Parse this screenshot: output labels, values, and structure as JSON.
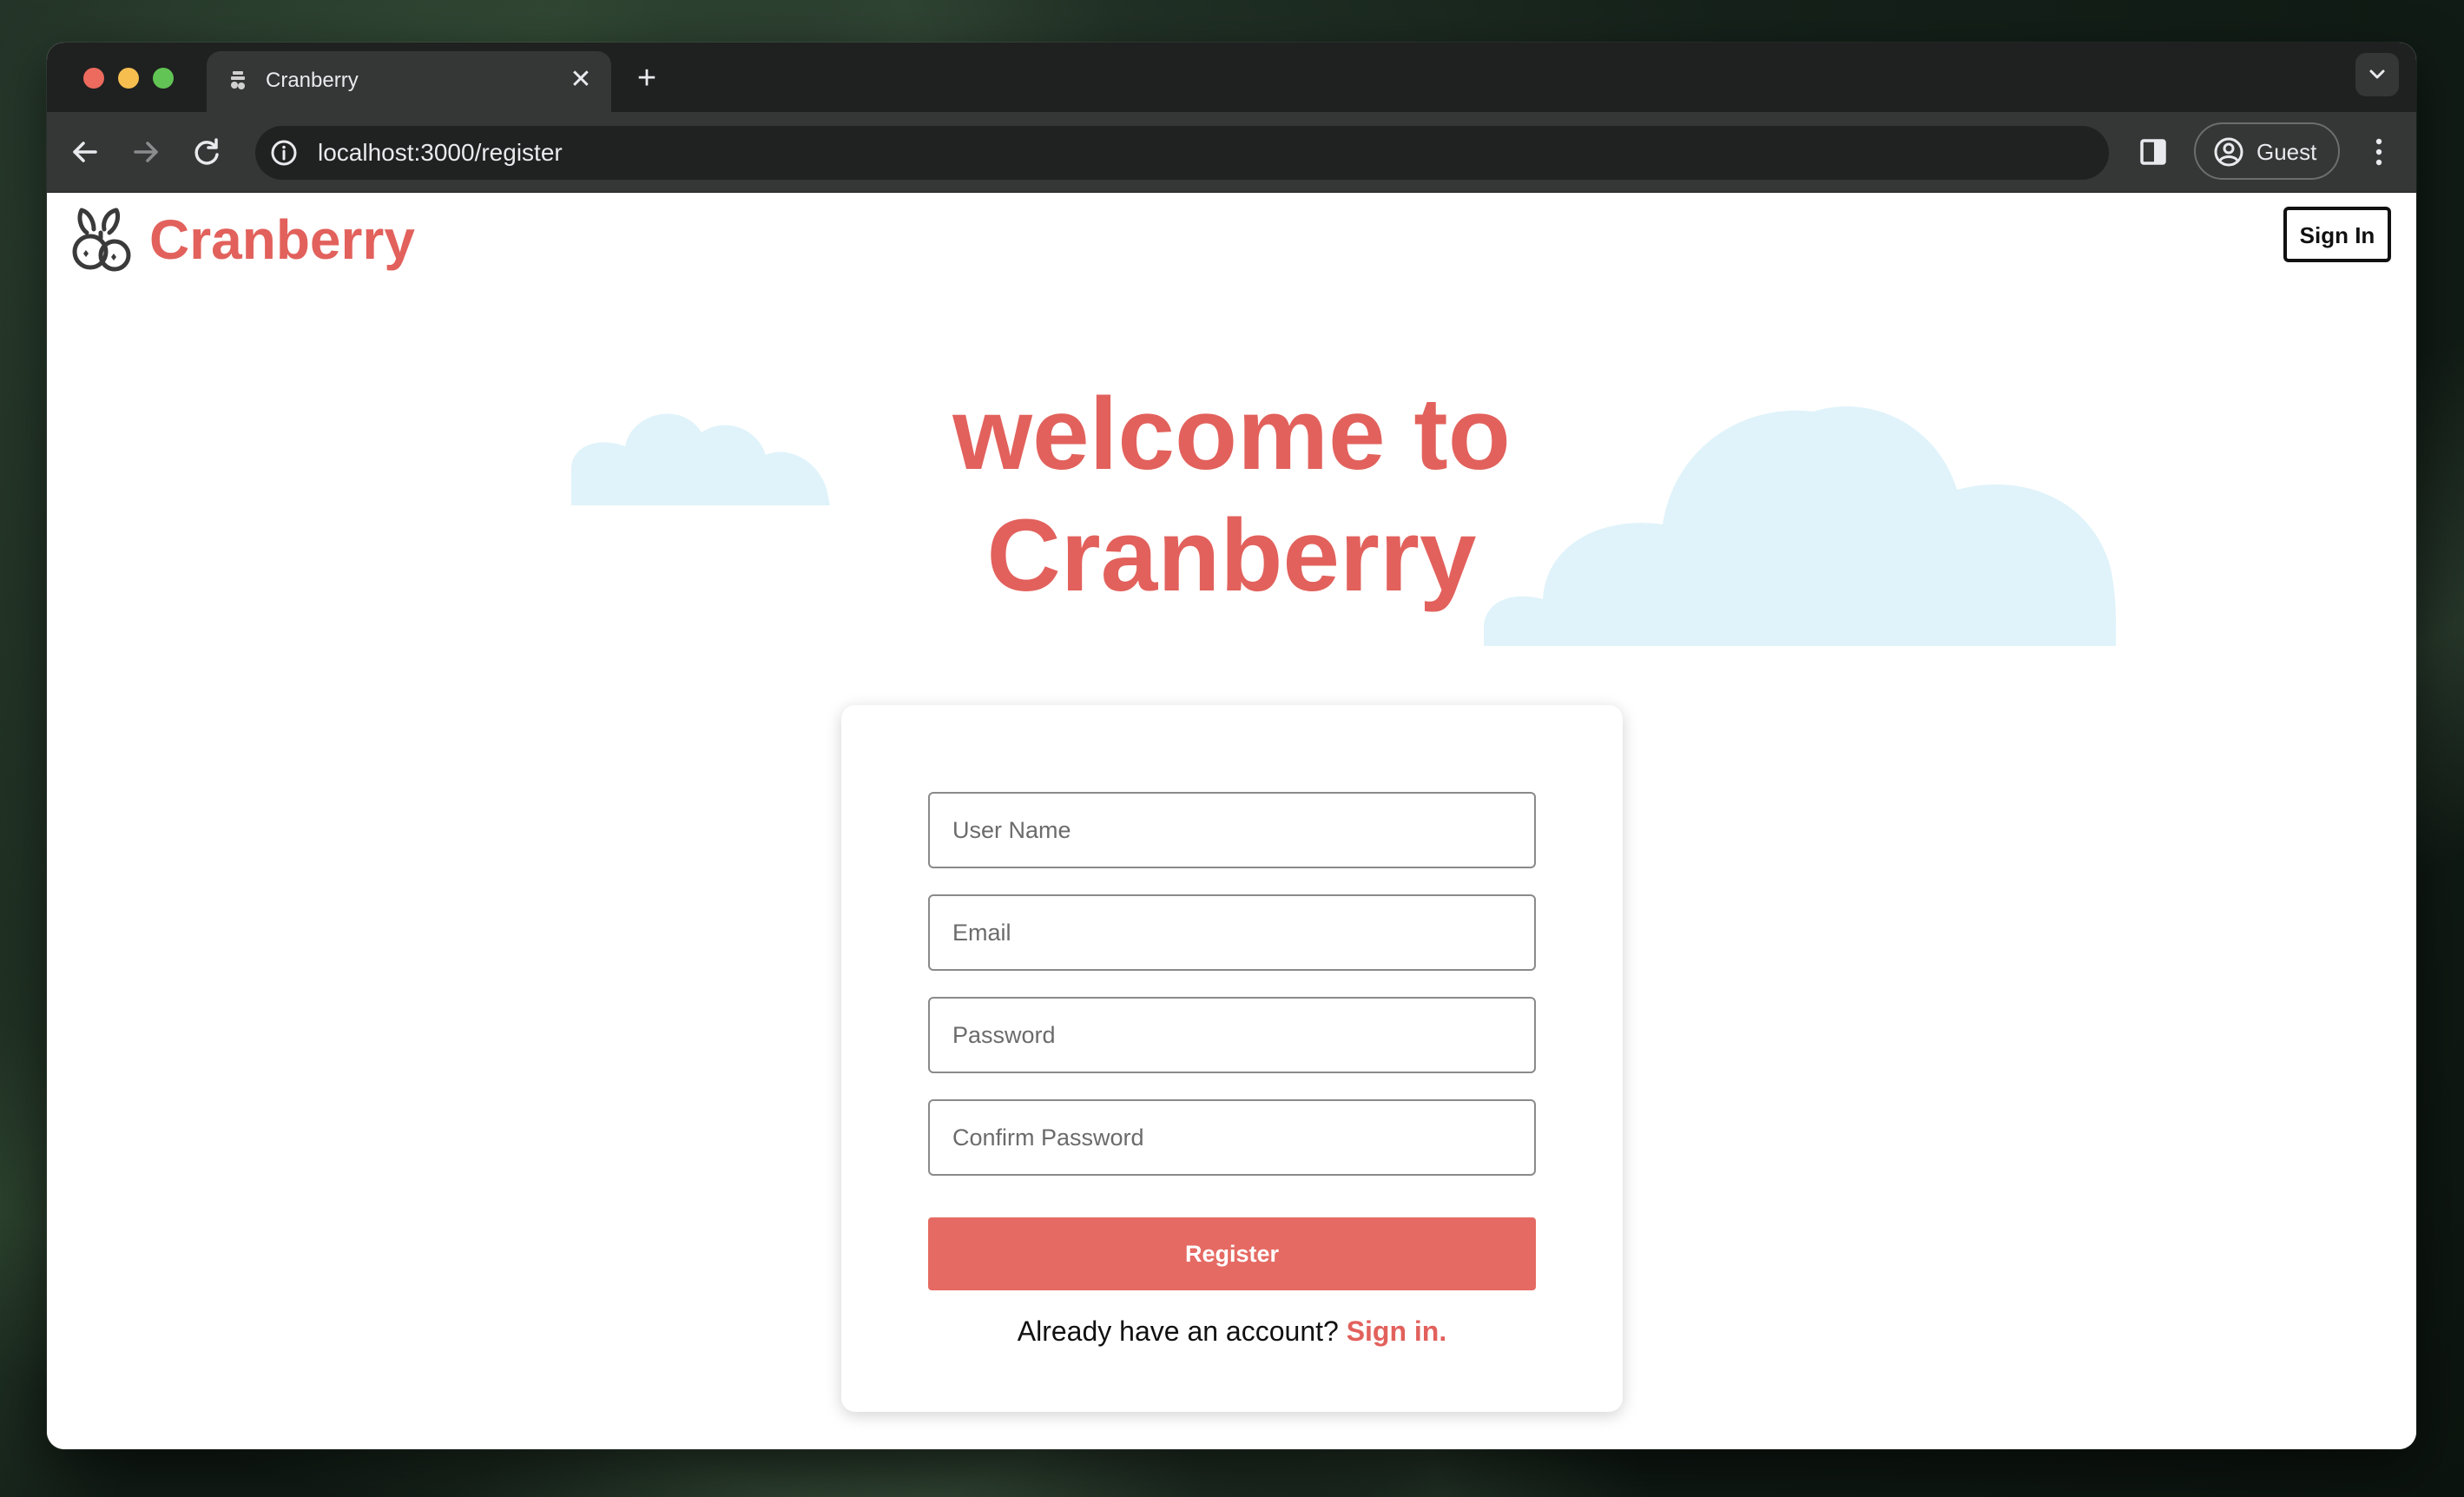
{
  "browser": {
    "tab_title": "Cranberry",
    "url": "localhost:3000/register",
    "profile_label": "Guest"
  },
  "header": {
    "logo_text": "Cranberry",
    "signin_label": "Sign In"
  },
  "hero": {
    "line1": "welcome to",
    "line2": "Cranberry"
  },
  "form": {
    "username_placeholder": "User Name",
    "email_placeholder": "Email",
    "password_placeholder": "Password",
    "confirm_placeholder": "Confirm Password",
    "register_label": "Register",
    "footer_prompt": "Already have an account?",
    "footer_link": "Sign in."
  },
  "colors": {
    "brand": "#e2615c",
    "button": "#e56a63",
    "cloud": "#e0f3fa"
  }
}
